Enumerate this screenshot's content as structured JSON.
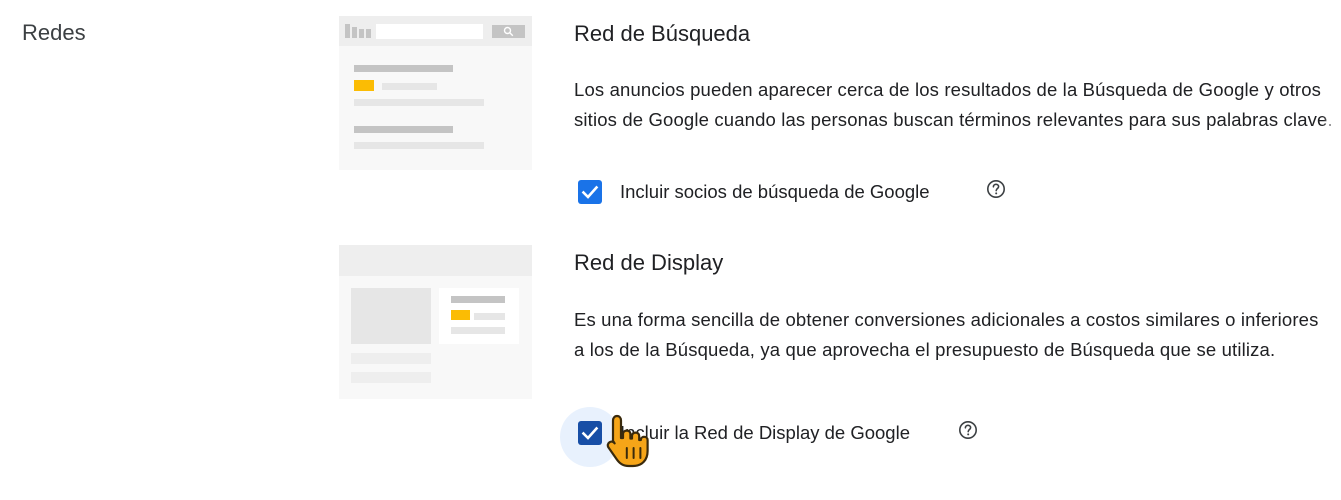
{
  "section": {
    "label": "Redes"
  },
  "search_network": {
    "title": "Red de Búsqueda",
    "description": "Los anuncios pueden aparecer cerca de los resultados de la Búsqueda de Google y otros sitios de Google cuando las personas buscan términos relevantes para sus palabras clave.",
    "checkbox_label": "Incluir socios de búsqueda de Google",
    "checked": true
  },
  "display_network": {
    "title": "Red de Display",
    "description": "Es una forma sencilla de obtener conversiones adicionales a costos similares o inferiores a los de la Búsqueda, ya que aprovecha el presupuesto de Búsqueda que se utiliza.",
    "checkbox_label": "Incluir la Red de Display de Google",
    "checked": true
  },
  "icons": {
    "checkbox": "check-icon",
    "help": "help-circle-icon",
    "cursor": "hand-pointer-icon"
  },
  "colors": {
    "checkbox": "#1a73e8",
    "checkbox_active": "#174ea6",
    "thumb_accent": "#fbbc04",
    "thumb_bg": "#f8f8f8"
  }
}
